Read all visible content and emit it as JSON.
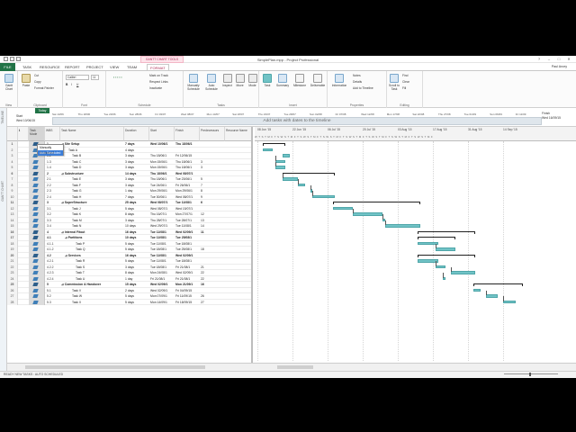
{
  "window": {
    "title": "SimplePlan.mpp - Project Professional",
    "context_tab": "GANTT CHART TOOLS",
    "controls": [
      "?",
      "–",
      "□",
      "✕"
    ]
  },
  "tabs": [
    "FILE",
    "TASK",
    "RESOURCE",
    "REPORT",
    "PROJECT",
    "VIEW",
    "TEAM",
    "FORMAT"
  ],
  "user": "Paul Arcey",
  "ribbon": {
    "groups": [
      {
        "label": "View",
        "buttons": [
          "Gantt Chart"
        ]
      },
      {
        "label": "Clipboard",
        "buttons": [
          "Paste",
          "Cut",
          "Copy",
          "Format Painter"
        ]
      },
      {
        "label": "Font",
        "buttons": [
          "Calibri",
          "11",
          "B",
          "I",
          "U"
        ]
      },
      {
        "label": "Schedule",
        "buttons": [
          "Mark on Track",
          "Respect Links",
          "Inactivate"
        ]
      },
      {
        "label": "Tasks",
        "buttons": [
          "Manually Schedule",
          "Auto Schedule",
          "Inspect",
          "Move",
          "Mode"
        ]
      },
      {
        "label": "Insert",
        "buttons": [
          "Task",
          "Summary",
          "Milestone",
          "Deliverable"
        ]
      },
      {
        "label": "Properties",
        "buttons": [
          "Information",
          "Notes",
          "Details",
          "Add to Timeline"
        ]
      },
      {
        "label": "Editing",
        "buttons": [
          "Scroll to Task",
          "Find",
          "Clear",
          "Fill"
        ]
      }
    ],
    "colors": {
      "accent": "#217346",
      "bar": "#71c3c6",
      "context": "#b0305a"
    }
  },
  "timeline": {
    "side_label": "TIMELINE",
    "today": "Today",
    "start_label": "Start",
    "start_date": "Wed 10/06/15",
    "finish_label": "Finish",
    "finish_date": "Wed 16/09/15",
    "scale": [
      "Sat 13/06",
      "Thu 18/06",
      "Tue 23/06",
      "Sun 28/06",
      "Fri 03/07",
      "Wed 08/07",
      "Mon 13/07",
      "Sat 18/07",
      "Thu 23/07",
      "Tue 28/07",
      "Sun 02/08",
      "Fri 07/08",
      "Wed 12/08",
      "Mon 17/08",
      "Sat 22/08",
      "Thu 27/08",
      "Tue 01/09",
      "Sun 06/09",
      "Fri 11/09"
    ],
    "message": "Add tasks with dates to the timeline"
  },
  "grid": {
    "side_label": "GANTT CHART",
    "headers": {
      "info": "ℹ",
      "mode": "Task Mode",
      "wbs": "WBS",
      "name": "Task Name",
      "duration": "Duration",
      "start": "Start",
      "finish": "Finish",
      "predecessors": "Predecessors",
      "resource": "Resource Name"
    },
    "mode_dropdown": [
      "Manually Scheduled",
      "Auto Scheduled"
    ],
    "rows": [
      {
        "n": "1",
        "wbs": "1",
        "name": "⊿ Site Setup",
        "dur": "7 days",
        "start": "Wed 10/06/1",
        "finish": "Thu 18/06/1",
        "pred": "",
        "sum": true
      },
      {
        "n": "2",
        "wbs": "",
        "name": "Task A",
        "dur": "4 days",
        "start": "",
        "finish": "",
        "pred": "",
        "sum": false
      },
      {
        "n": "3",
        "wbs": "1.2",
        "name": "Task B",
        "dur": "3 days",
        "start": "Thu 18/06/1",
        "finish": "Fri 12/06/15",
        "pred": "",
        "sum": false
      },
      {
        "n": "4",
        "wbs": "1.3",
        "name": "Task C",
        "dur": "3 days",
        "start": "Mon 15/06/1",
        "finish": "Thu 18/06/1",
        "pred": "3",
        "sum": false
      },
      {
        "n": "5",
        "wbs": "1.4",
        "name": "Task D",
        "dur": "3 days",
        "start": "Mon 15/06/1",
        "finish": "Thu 18/06/1",
        "pred": "3",
        "sum": false
      },
      {
        "n": "6",
        "wbs": "2",
        "name": "⊿ Substructure",
        "dur": "14 days",
        "start": "Thu 18/06/1",
        "finish": "Wed 08/07/1",
        "pred": "",
        "sum": true
      },
      {
        "n": "7",
        "wbs": "2.1",
        "name": "Task E",
        "dur": "3 days",
        "start": "Thu 18/06/1",
        "finish": "Tue 23/06/1",
        "pred": "5",
        "sum": false
      },
      {
        "n": "8",
        "wbs": "2.2",
        "name": "Task F",
        "dur": "3 days",
        "start": "Tue 24/06/1",
        "finish": "Fri 26/06/1",
        "pred": "7",
        "sum": false
      },
      {
        "n": "9",
        "wbs": "2.3",
        "name": "Task G",
        "dur": "1 day",
        "start": "Mon 29/06/1",
        "finish": "Mon 29/06/1",
        "pred": "8",
        "sum": false
      },
      {
        "n": "10",
        "wbs": "2.4",
        "name": "Task H",
        "dur": "7 days",
        "start": "Tue 30/06/1",
        "finish": "Wed 08/07/1",
        "pred": "9",
        "sum": false
      },
      {
        "n": "11",
        "wbs": "3",
        "name": "⊿ SuperStructure",
        "dur": "25 days",
        "start": "Wed 08/07/1",
        "finish": "Tue 11/08/1",
        "pred": "6",
        "sum": true
      },
      {
        "n": "12",
        "wbs": "3.1",
        "name": "Task J",
        "dur": "5 days",
        "start": "Wed 08/07/1",
        "finish": "Wed 15/07/1",
        "pred": "",
        "sum": false
      },
      {
        "n": "13",
        "wbs": "3.2",
        "name": "Task K",
        "dur": "8 days",
        "start": "Thu 16/07/1",
        "finish": "Mon 27/07/1",
        "pred": "12",
        "sum": false
      },
      {
        "n": "14",
        "wbs": "3.3",
        "name": "Task M",
        "dur": "3 days",
        "start": "Thu 28/07/1",
        "finish": "Tue 28/07/1",
        "pred": "13",
        "sum": false
      },
      {
        "n": "15",
        "wbs": "3.4",
        "name": "Task N",
        "dur": "10 days",
        "start": "Wed 29/07/1",
        "finish": "Tue 11/08/1",
        "pred": "14",
        "sum": false
      },
      {
        "n": "16",
        "wbs": "4",
        "name": "⊿ Internal Fitout",
        "dur": "16 days",
        "start": "Tue 11/08/1",
        "finish": "Wed 02/09/1",
        "pred": "11",
        "sum": true
      },
      {
        "n": "17",
        "wbs": "4.1",
        "name": "⊿ Partitions",
        "dur": "10 days",
        "start": "Tue 11/08/1",
        "finish": "Tue 25/08/1",
        "pred": "",
        "sum": true
      },
      {
        "n": "18",
        "wbs": "4.1.1",
        "name": "Task P",
        "dur": "5 days",
        "start": "Tue 11/08/1",
        "finish": "Tue 18/08/1",
        "pred": "",
        "sum": false
      },
      {
        "n": "19",
        "wbs": "4.1.2",
        "name": "Task Q",
        "dur": "5 days",
        "start": "Tue 18/08/1",
        "finish": "Tue 25/08/1",
        "pred": "18",
        "sum": false
      },
      {
        "n": "20",
        "wbs": "4.2",
        "name": "⊿ Services",
        "dur": "16 days",
        "start": "Tue 11/08/1",
        "finish": "Wed 02/09/1",
        "pred": "",
        "sum": true
      },
      {
        "n": "21",
        "wbs": "4.2.1",
        "name": "Task R",
        "dur": "5 days",
        "start": "Tue 11/08/1",
        "finish": "Tue 18/08/1",
        "pred": "",
        "sum": false
      },
      {
        "n": "22",
        "wbs": "4.2.2",
        "name": "Task S",
        "dur": "3 days",
        "start": "Tue 18/08/1",
        "finish": "Fri 21/08/1",
        "pred": "21",
        "sum": false
      },
      {
        "n": "23",
        "wbs": "4.2.3",
        "name": "Task T",
        "dur": "8 days",
        "start": "Mon 24/08/1",
        "finish": "Wed 02/09/1",
        "pred": "22",
        "sum": false
      },
      {
        "n": "24",
        "wbs": "4.2.4",
        "name": "Task U",
        "dur": "1 day",
        "start": "Fri 21/08/1",
        "finish": "Fri 21/08/1",
        "pred": "22",
        "sum": false
      },
      {
        "n": "25",
        "wbs": "5",
        "name": "⊿ Commission & Handover",
        "dur": "15 days",
        "start": "Wed 02/09/1",
        "finish": "Mon 21/09/1",
        "pred": "16",
        "sum": true
      },
      {
        "n": "26",
        "wbs": "5.1",
        "name": "Task V",
        "dur": "2 days",
        "start": "Wed 02/09/1",
        "finish": "Fri 04/09/15",
        "pred": "",
        "sum": false
      },
      {
        "n": "27",
        "wbs": "5.2",
        "name": "Task W",
        "dur": "5 days",
        "start": "Mon 07/09/1",
        "finish": "Fri 11/09/15",
        "pred": "26",
        "sum": false
      },
      {
        "n": "28",
        "wbs": "5.3",
        "name": "Task X",
        "dur": "5 days",
        "start": "Mon 14/09/1",
        "finish": "Fri 18/09/15",
        "pred": "27",
        "sum": false
      }
    ]
  },
  "chart": {
    "weeks": [
      "08 Jun '15",
      "22 Jun '15",
      "06 Jul '15",
      "20 Jul '15",
      "03 Aug '15",
      "17 Aug '15",
      "31 Aug '15",
      "14 Sep '15"
    ],
    "day_letters": "W T S T M F T S W S T M F T S W S T M F T S W S T M F T S W S T M F T S W S T M F T S W S T M F T S W S T M F"
  },
  "status": {
    "text": "READY   NEW TASKS : AUTO SCHEDULED"
  }
}
